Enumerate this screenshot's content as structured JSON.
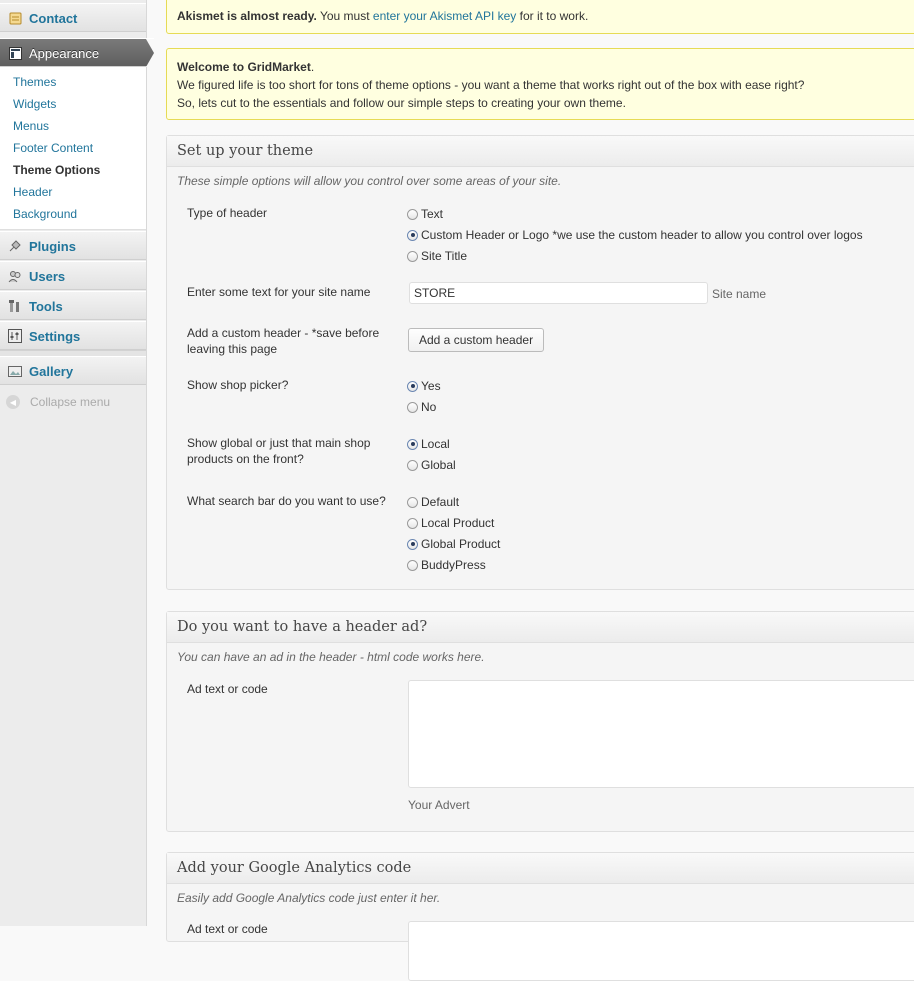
{
  "sidebar": {
    "contact": "Contact",
    "appearance": "Appearance",
    "submenu": [
      "Themes",
      "Widgets",
      "Menus",
      "Footer Content",
      "Theme Options",
      "Header",
      "Background"
    ],
    "plugins": "Plugins",
    "users": "Users",
    "tools": "Tools",
    "settings": "Settings",
    "gallery": "Gallery",
    "collapse": "Collapse menu"
  },
  "akismet": {
    "bold": "Akismet is almost ready.",
    "pre": " You must ",
    "link": "enter your Akismet API key",
    "post": " for it to work."
  },
  "welcome": {
    "title": "Welcome to GridMarket",
    "title_end": ".",
    "line1": "We figured life is too short for tons of theme options - you want a theme that works right out of the box with ease right?",
    "line2": "So, lets cut to the essentials and follow our simple steps to creating your own theme."
  },
  "setup": {
    "title": "Set up your theme",
    "desc": "These simple options will allow you control over some areas of your site.",
    "header_type": {
      "label": "Type of header",
      "options": [
        "Text",
        "Custom Header or Logo *we use the custom header to allow you control over logos",
        "Site Title"
      ]
    },
    "site_name": {
      "label": "Enter some text for your site name",
      "value": "STORE",
      "hint": "Site name"
    },
    "custom_header": {
      "label": "Add a custom header - *save before leaving this page",
      "button": "Add a custom header"
    },
    "shop_picker": {
      "label": "Show shop picker?",
      "options": [
        "Yes",
        "No"
      ]
    },
    "global_local": {
      "label": "Show global or just that main shop products on the front?",
      "options": [
        "Local",
        "Global"
      ]
    },
    "search_bar": {
      "label": "What search bar do you want to use?",
      "options": [
        "Default",
        "Local Product",
        "Global Product",
        "BuddyPress"
      ]
    }
  },
  "header_ad": {
    "title": "Do you want to have a header ad?",
    "desc": "You can have an ad in the header - html code works here.",
    "label": "Ad text or code",
    "hint": "Your Advert"
  },
  "analytics": {
    "title": "Add your Google Analytics code",
    "desc": "Easily add Google Analytics code just enter it her.",
    "label": "Ad text or code"
  },
  "colors": {
    "link": "#21759b",
    "notice_bg": "#ffffe0",
    "notice_border": "#e6db55",
    "active_menu": "#6d6d6d"
  }
}
